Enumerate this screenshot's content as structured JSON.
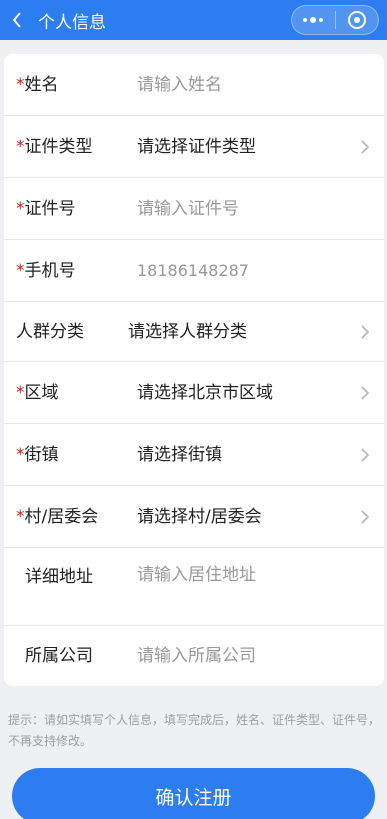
{
  "header": {
    "title": "个人信息"
  },
  "form": {
    "required_mark": "*",
    "fields": [
      {
        "label": "姓名",
        "value": "请输入姓名"
      },
      {
        "label": "证件类型",
        "value": "请选择证件类型"
      },
      {
        "label": "证件号",
        "value": "请输入证件号"
      },
      {
        "label": "手机号",
        "value": "18186148287"
      },
      {
        "label": "人群分类",
        "value": "请选择人群分类"
      },
      {
        "label": "区域",
        "value": "请选择北京市区域"
      },
      {
        "label": "街镇",
        "value": "请选择街镇"
      },
      {
        "label": "村/居委会",
        "value": "请选择村/居委会"
      },
      {
        "label": "详细地址",
        "value": "请输入居住地址"
      },
      {
        "label": "所属公司",
        "value": "请输入所属公司"
      }
    ]
  },
  "tip": {
    "text": "提示：请如实填写个人信息，填写完成后，姓名、证件类型、证件号，不再支持修改。"
  },
  "submit": {
    "label": "确认注册"
  },
  "colors": {
    "brand": "#2b7df0",
    "required": "#c81e1e",
    "placeholder": "#999999"
  }
}
